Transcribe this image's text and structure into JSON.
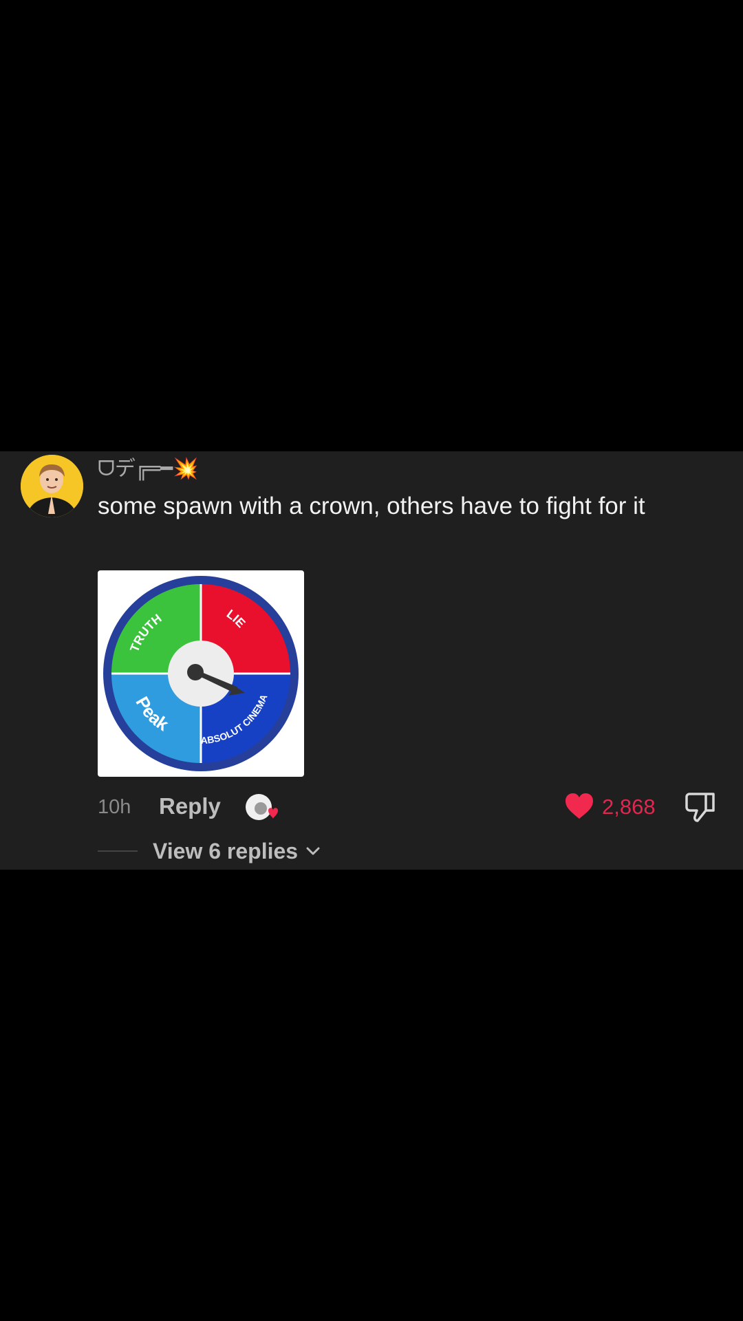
{
  "comment": {
    "username": "ᗜデ╔═━",
    "username_emoji": "💥",
    "text": "some spawn with a crown, others have to fight for it",
    "media": {
      "segments": [
        "TRUTH",
        "LIE",
        "Peak",
        "ABSOLUT CINEMA"
      ],
      "colors": {
        "truth": "#3bc33d",
        "lie": "#e8102c",
        "peak": "#2f9ce0",
        "cinema": "#1741c4",
        "rim": "#253f9a"
      }
    },
    "time": "10h",
    "reply_label": "Reply",
    "like_count": "2,868",
    "view_replies_label": "View 6 replies"
  },
  "colors": {
    "panel": "#1f1f1f",
    "like": "#e0274f",
    "avatar_bg": "#f6c526"
  },
  "icons": {
    "like": "heart-icon",
    "dislike": "thumbs-down-icon",
    "creator": "creator-liked-icon",
    "expand": "chevron-down-icon"
  }
}
